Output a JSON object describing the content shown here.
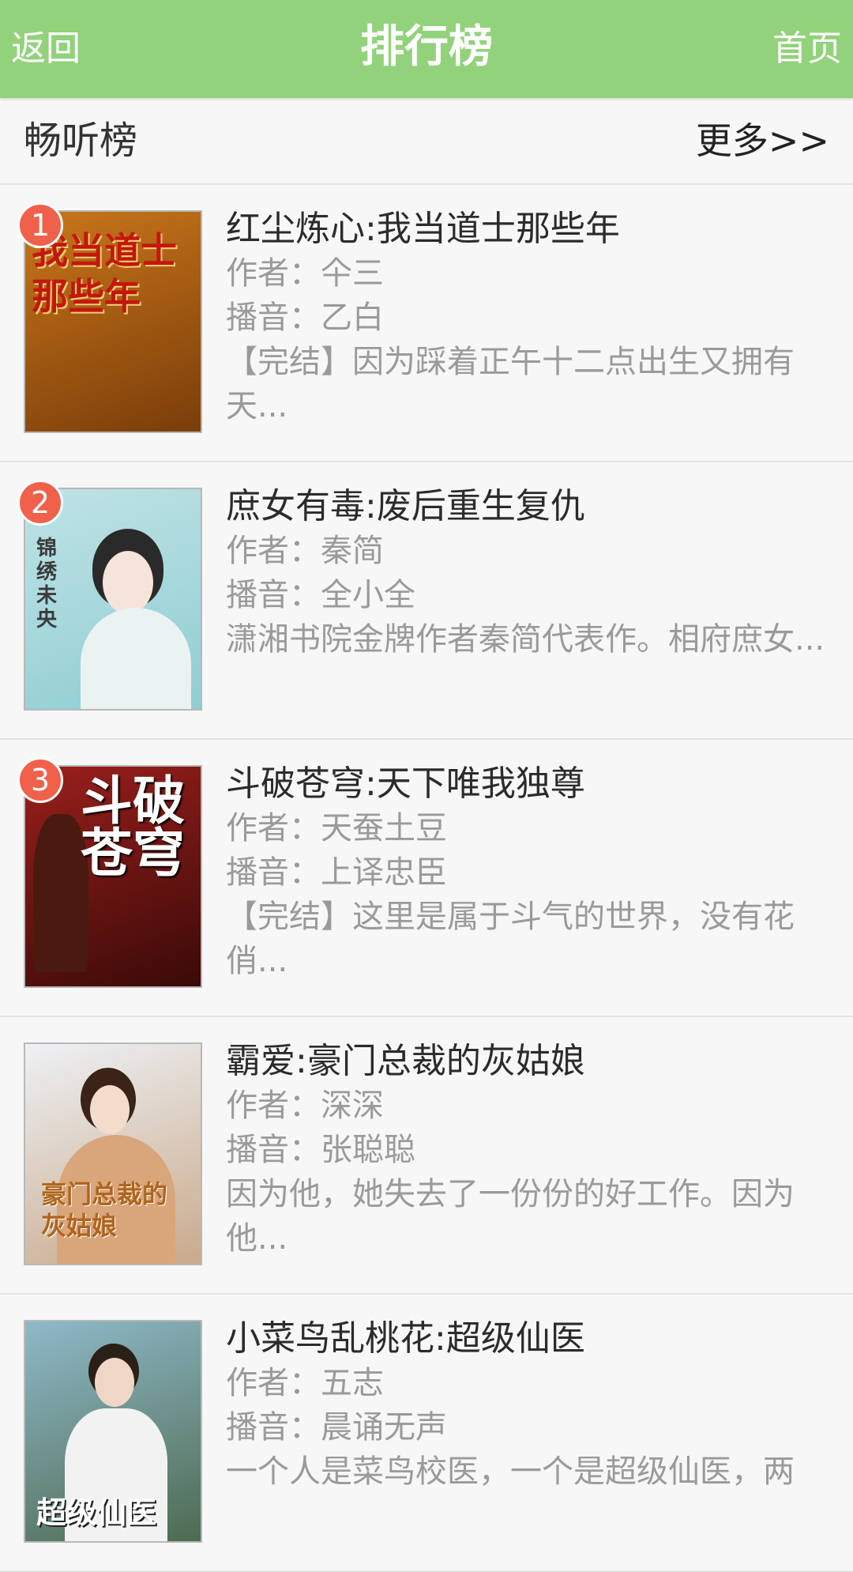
{
  "topbar": {
    "back_label": "返回",
    "title": "排行榜",
    "home_label": "首页"
  },
  "section": {
    "title": "畅听榜",
    "more_label": "更多>>"
  },
  "labels": {
    "author_prefix": "作者：",
    "narrator_prefix": "播音："
  },
  "books": [
    {
      "rank": "1",
      "title": "红尘炼心:我当道士那些年",
      "author": "仐三",
      "narrator": "乙白",
      "desc": "【完结】因为踩着正午十二点出生又拥有天...",
      "cover_text": "我当道士那些年",
      "cover_colors": [
        "#c9761a",
        "#7a3d0a"
      ]
    },
    {
      "rank": "2",
      "title": "庶女有毒:废后重生复仇",
      "author": "秦简",
      "narrator": "全小全",
      "desc": "潇湘书院金牌作者秦简代表作。相府庶女...",
      "cover_text": "锦绣未央",
      "cover_colors": [
        "#bfe3e6",
        "#8fcdd2"
      ]
    },
    {
      "rank": "3",
      "title": "斗破苍穹:天下唯我独尊",
      "author": "天蚕土豆",
      "narrator": "上译忠臣",
      "desc": "【完结】这里是属于斗气的世界，没有花俏...",
      "cover_text": "斗破苍穹",
      "cover_colors": [
        "#9a1f1c",
        "#3a0a08"
      ]
    },
    {
      "rank": "",
      "title": "霸爱:豪门总裁的灰姑娘",
      "author": "深深",
      "narrator": "张聪聪",
      "desc": "因为他，她失去了一份份的好工作。因为他...",
      "cover_text": "豪门总裁的灰姑娘",
      "cover_colors": [
        "#eef1f5",
        "#c9a98a"
      ]
    },
    {
      "rank": "",
      "title": "小菜鸟乱桃花:超级仙医",
      "author": "五志",
      "narrator": "晨诵无声",
      "desc": "一个人是菜鸟校医，一个是超级仙医，两",
      "cover_text": "超级仙医",
      "cover_colors": [
        "#8fb9c9",
        "#4d6b52"
      ]
    }
  ]
}
